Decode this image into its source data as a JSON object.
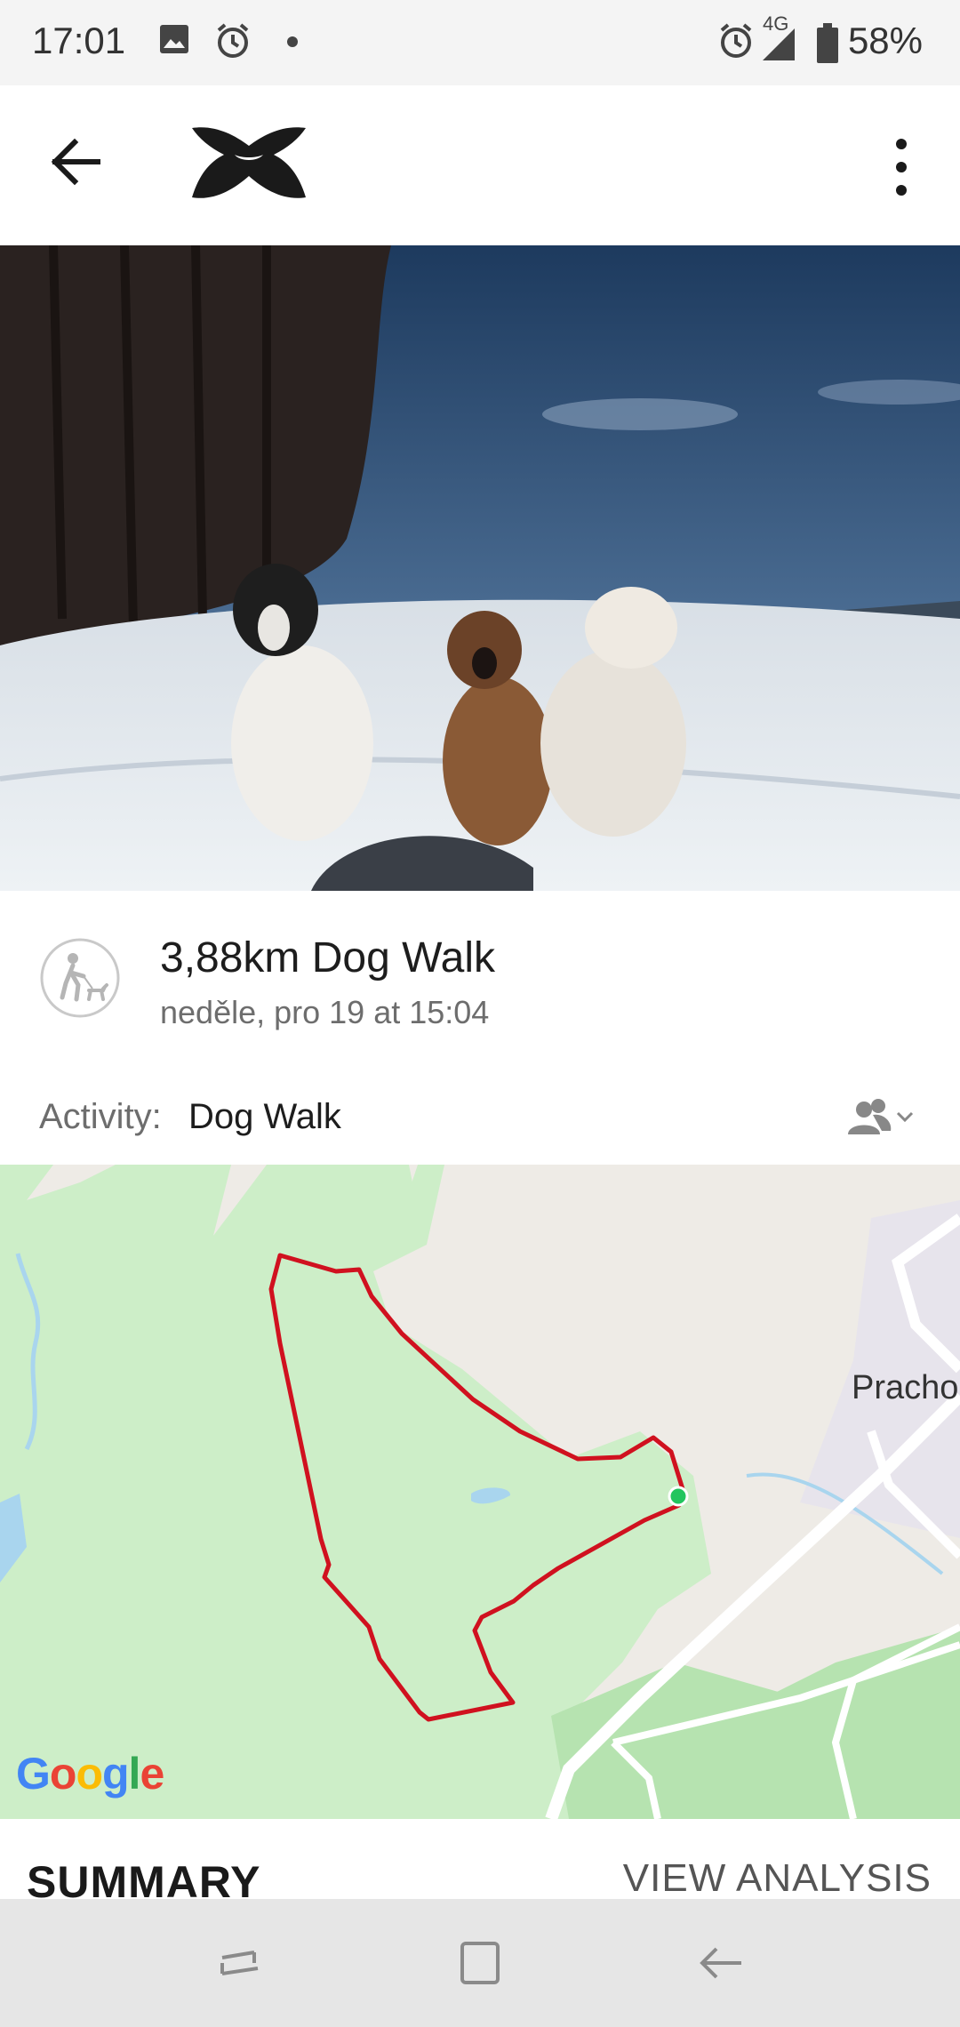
{
  "status_bar": {
    "time": "17:01",
    "network": "4G",
    "battery": "58%",
    "icons": [
      "image-icon",
      "alarm-icon",
      "dot-icon",
      "alarm-icon",
      "signal-icon",
      "battery-icon"
    ]
  },
  "app_bar": {
    "back_icon": "back-arrow-icon",
    "logo": "under-armour-logo",
    "menu_icon": "more-vert-icon"
  },
  "workout": {
    "title": "3,88km Dog Walk",
    "subtitle": "neděle, pro 19 at 15:04",
    "activity_label": "Activity:",
    "activity_value": "Dog Walk",
    "activity_icon": "dog-walk-icon",
    "privacy_icon": "friends-privacy-icon"
  },
  "map": {
    "place_label": "Pracho",
    "attribution": "Google",
    "route_color": "#d0111f",
    "start_marker_color": "#22c55e"
  },
  "summary": {
    "heading": "SUMMARY",
    "action": "VIEW ANALYSIS"
  },
  "colors": {
    "accent": "#d0111f",
    "map_green": "#cdeec8",
    "map_base": "#eeebe6"
  }
}
